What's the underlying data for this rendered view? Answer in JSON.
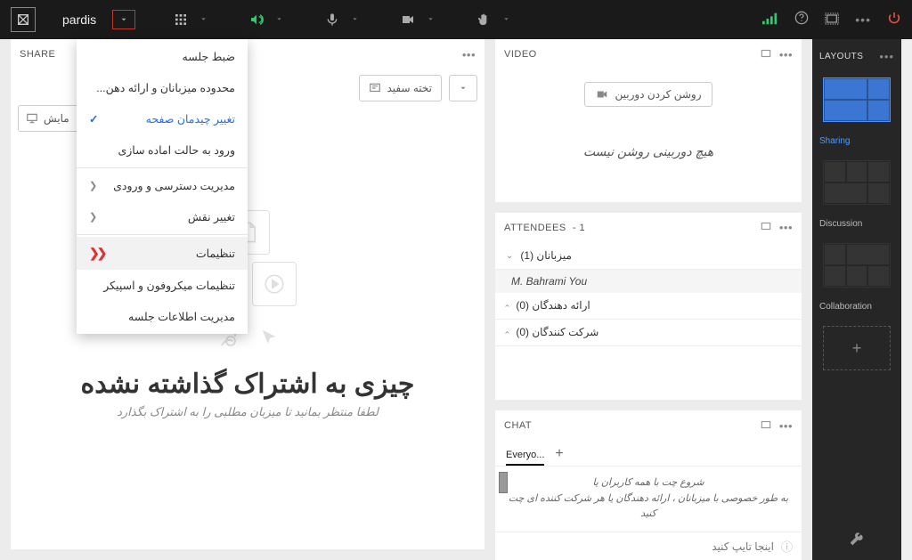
{
  "topbar": {
    "room_name": "pardis"
  },
  "layouts": {
    "header": "LAYOUTS",
    "items": [
      {
        "label": "Sharing",
        "active": true
      },
      {
        "label": "Discussion",
        "active": false
      },
      {
        "label": "Collaboration",
        "active": false
      }
    ]
  },
  "share": {
    "title": "SHARE",
    "screen_btn": "مایش",
    "wb_btn": "تخته سفید",
    "big_text": "چیزی به اشتراک گذاشته نشده",
    "sub_text": "لطفا منتظر بمانید تا میزبان مطلبی را به اشتراک بگذارد"
  },
  "video": {
    "title": "VIDEO",
    "btn": "روشن کردن دوربین",
    "empty": "هیچ دوربینی روشن نیست"
  },
  "attendees": {
    "title": "ATTENDEES",
    "count": "- 1",
    "hosts_label": "میزبانان (1)",
    "user": "M. Bahrami You",
    "presenters_label": "ارائه دهندگان (0)",
    "participants_label": "شرکت کنندگان (0)"
  },
  "chat": {
    "title": "CHAT",
    "tab": "Everyo...",
    "hint_l1": "شروع چت با همه کاربران یا",
    "hint_l2": "به طور خصوصی با میزبانان ، ارائه دهندگان یا هر شرکت کننده ای چت کنید",
    "input_placeholder": "اینجا تایپ کنید"
  },
  "menu": {
    "record": "ضبط جلسه",
    "host_area": "محدوده میزبانان و ارائه دهن...",
    "change_layout": "تغییر چیدمان صفحه",
    "prepare_mode": "ورود به حالت اماده سازی",
    "access": "مدیریت دسترسی و ورودی",
    "role": "تغییر نقش",
    "settings": "تنظیمات",
    "mic_speaker": "تنظیمات میکروفون و اسپیکر",
    "meeting_info": "مدیریت اطلاعات جلسه"
  }
}
